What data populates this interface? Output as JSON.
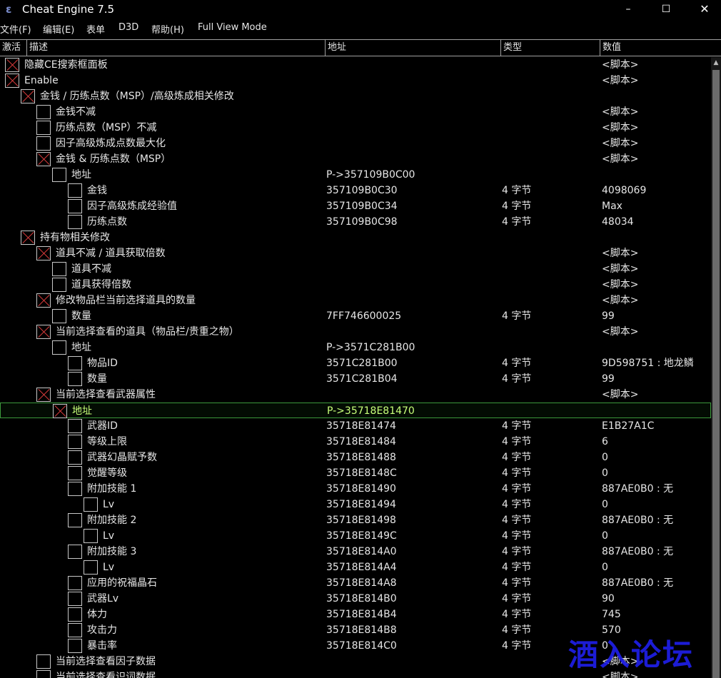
{
  "window": {
    "title": "Cheat Engine 7.5",
    "controls": {
      "minimize": "–",
      "maximize": "☐",
      "close": "✕"
    }
  },
  "menu": [
    "文件(F)",
    "编辑(E)",
    "表单",
    "D3D",
    "帮助(H)",
    "Full View Mode"
  ],
  "columns": {
    "active": "激活",
    "description": "描述",
    "address": "地址",
    "type": "类型",
    "value": "数值"
  },
  "rows": [
    {
      "level": 0,
      "checked": true,
      "desc": "隐藏CE搜索框面板",
      "addr": "",
      "type": "",
      "value": "<脚本>"
    },
    {
      "level": 0,
      "checked": true,
      "desc": "Enable",
      "addr": "",
      "type": "",
      "value": "<脚本>"
    },
    {
      "level": 1,
      "checked": true,
      "desc": "金钱 / 历练点数（MSP）/高级炼成相关修改",
      "addr": "",
      "type": "",
      "value": ""
    },
    {
      "level": 2,
      "checked": false,
      "desc": "金钱不减",
      "addr": "",
      "type": "",
      "value": "<脚本>"
    },
    {
      "level": 2,
      "checked": false,
      "desc": "历练点数（MSP）不减",
      "addr": "",
      "type": "",
      "value": "<脚本>"
    },
    {
      "level": 2,
      "checked": false,
      "desc": "因子高级炼成点数最大化",
      "addr": "",
      "type": "",
      "value": "<脚本>"
    },
    {
      "level": 2,
      "checked": true,
      "desc": "金钱 & 历练点数（MSP）",
      "addr": "",
      "type": "",
      "value": "<脚本>"
    },
    {
      "level": 3,
      "checked": false,
      "desc": "地址",
      "addr": "P->357109B0C00",
      "type": "",
      "value": ""
    },
    {
      "level": 4,
      "checked": false,
      "desc": "金钱",
      "addr": "357109B0C30",
      "type": "4 字节",
      "value": "4098069"
    },
    {
      "level": 4,
      "checked": false,
      "desc": "因子高级炼成经验值",
      "addr": "357109B0C34",
      "type": "4 字节",
      "value": "Max"
    },
    {
      "level": 4,
      "checked": false,
      "desc": "历练点数",
      "addr": "357109B0C98",
      "type": "4 字节",
      "value": "48034"
    },
    {
      "level": 1,
      "checked": true,
      "desc": "持有物相关修改",
      "addr": "",
      "type": "",
      "value": ""
    },
    {
      "level": 2,
      "checked": true,
      "desc": "道具不减 / 道具获取倍数",
      "addr": "",
      "type": "",
      "value": "<脚本>"
    },
    {
      "level": 3,
      "checked": false,
      "desc": "道具不减",
      "addr": "",
      "type": "",
      "value": "<脚本>"
    },
    {
      "level": 3,
      "checked": false,
      "desc": "道具获得倍数",
      "addr": "",
      "type": "",
      "value": "<脚本>"
    },
    {
      "level": 2,
      "checked": true,
      "desc": "修改物品栏当前选择道具的数量",
      "addr": "",
      "type": "",
      "value": "<脚本>"
    },
    {
      "level": 3,
      "checked": false,
      "desc": "数量",
      "addr": "7FF746600025",
      "type": "4 字节",
      "value": "99"
    },
    {
      "level": 2,
      "checked": true,
      "desc": "当前选择查看的道具（物品栏/贵重之物）",
      "addr": "",
      "type": "",
      "value": "<脚本>"
    },
    {
      "level": 3,
      "checked": false,
      "desc": "地址",
      "addr": "P->3571C281B00",
      "type": "",
      "value": ""
    },
    {
      "level": 4,
      "checked": false,
      "desc": "物品ID",
      "addr": "3571C281B00",
      "type": "4 字节",
      "value": "9D598751 : 地龙鳞"
    },
    {
      "level": 4,
      "checked": false,
      "desc": "数量",
      "addr": "3571C281B04",
      "type": "4 字节",
      "value": "99"
    },
    {
      "level": 2,
      "checked": true,
      "desc": "当前选择查看武器属性",
      "addr": "",
      "type": "",
      "value": "<脚本>"
    },
    {
      "level": 3,
      "checked": true,
      "selected": true,
      "desc": "地址",
      "addr": "P->35718E81470",
      "type": "",
      "value": ""
    },
    {
      "level": 4,
      "checked": false,
      "desc": "武器ID",
      "addr": "35718E81474",
      "type": "4 字节",
      "value": "E1B27A1C"
    },
    {
      "level": 4,
      "checked": false,
      "desc": "等级上限",
      "addr": "35718E81484",
      "type": "4 字节",
      "value": "6"
    },
    {
      "level": 4,
      "checked": false,
      "desc": "武器幻晶赋予数",
      "addr": "35718E81488",
      "type": "4 字节",
      "value": "0"
    },
    {
      "level": 4,
      "checked": false,
      "desc": "觉醒等级",
      "addr": "35718E8148C",
      "type": "4 字节",
      "value": "0"
    },
    {
      "level": 4,
      "checked": false,
      "desc": "附加技能 1",
      "addr": "35718E81490",
      "type": "4 字节",
      "value": "887AE0B0 : 无"
    },
    {
      "level": 5,
      "checked": false,
      "desc": "Lv",
      "addr": "35718E81494",
      "type": "4 字节",
      "value": "0"
    },
    {
      "level": 4,
      "checked": false,
      "desc": "附加技能 2",
      "addr": "35718E81498",
      "type": "4 字节",
      "value": "887AE0B0 : 无"
    },
    {
      "level": 5,
      "checked": false,
      "desc": "Lv",
      "addr": "35718E8149C",
      "type": "4 字节",
      "value": "0"
    },
    {
      "level": 4,
      "checked": false,
      "desc": "附加技能 3",
      "addr": "35718E814A0",
      "type": "4 字节",
      "value": "887AE0B0 : 无"
    },
    {
      "level": 5,
      "checked": false,
      "desc": "Lv",
      "addr": "35718E814A4",
      "type": "4 字节",
      "value": "0"
    },
    {
      "level": 4,
      "checked": false,
      "desc": "应用的祝福晶石",
      "addr": "35718E814A8",
      "type": "4 字节",
      "value": "887AE0B0 : 无"
    },
    {
      "level": 4,
      "checked": false,
      "desc": "武器Lv",
      "addr": "35718E814B0",
      "type": "4 字节",
      "value": "90"
    },
    {
      "level": 4,
      "checked": false,
      "desc": "体力",
      "addr": "35718E814B4",
      "type": "4 字节",
      "value": "745"
    },
    {
      "level": 4,
      "checked": false,
      "desc": "攻击力",
      "addr": "35718E814B8",
      "type": "4 字节",
      "value": "570"
    },
    {
      "level": 4,
      "checked": false,
      "desc": "暴击率",
      "addr": "35718E814C0",
      "type": "4 字节",
      "value": "0"
    },
    {
      "level": 2,
      "checked": false,
      "desc": "当前选择查看因子数据",
      "addr": "",
      "type": "",
      "value": "<脚本>"
    },
    {
      "level": 2,
      "checked": false,
      "desc": "当前选择查看识词数据",
      "addr": "",
      "type": "",
      "value": "<脚本>"
    }
  ],
  "watermark": "酒入论坛",
  "colors": {
    "check_mark": "#d23a3a",
    "selection_border": "#3c9a3c",
    "selection_text": "#c8ff7a",
    "watermark": "#1f1fe8"
  }
}
